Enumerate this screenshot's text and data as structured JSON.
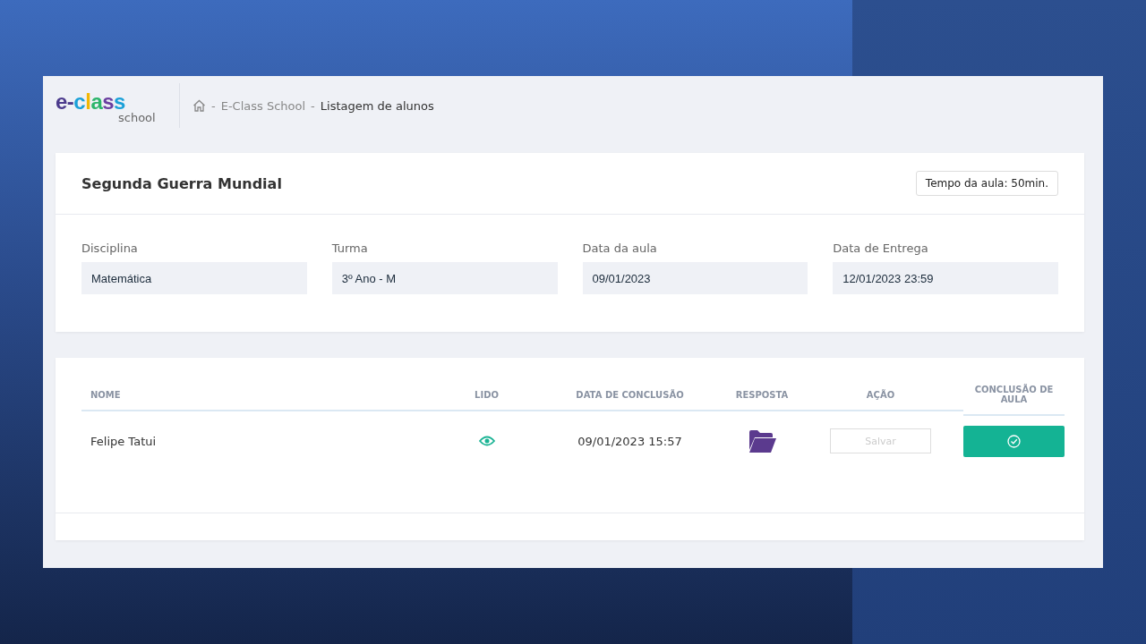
{
  "logo": {
    "word": "e-class",
    "sub": "school"
  },
  "breadcrumb": {
    "items": [
      "E-Class School",
      "Listagem de alunos"
    ],
    "separator": "-"
  },
  "lesson": {
    "title": "Segunda Guerra Mundial",
    "duration": "Tempo da aula: 50min.",
    "fields": [
      {
        "label": "Disciplina",
        "value": "Matemática"
      },
      {
        "label": "Turma",
        "value": "3º Ano - M"
      },
      {
        "label": "Data da aula",
        "value": "09/01/2023"
      },
      {
        "label": "Data de Entrega",
        "value": "12/01/2023 23:59"
      }
    ]
  },
  "table": {
    "columns": [
      "NOME",
      "LIDO",
      "DATA DE CONCLUSÃO",
      "RESPOSTA",
      "AÇÃO",
      "CONCLUSÃO DE AULA"
    ],
    "rows": [
      {
        "name": "Felipe Tatui",
        "read": true,
        "completed_at": "09/01/2023 15:57",
        "save": {
          "label": "Salvar",
          "disabled": true
        },
        "concluded": true
      }
    ]
  }
}
